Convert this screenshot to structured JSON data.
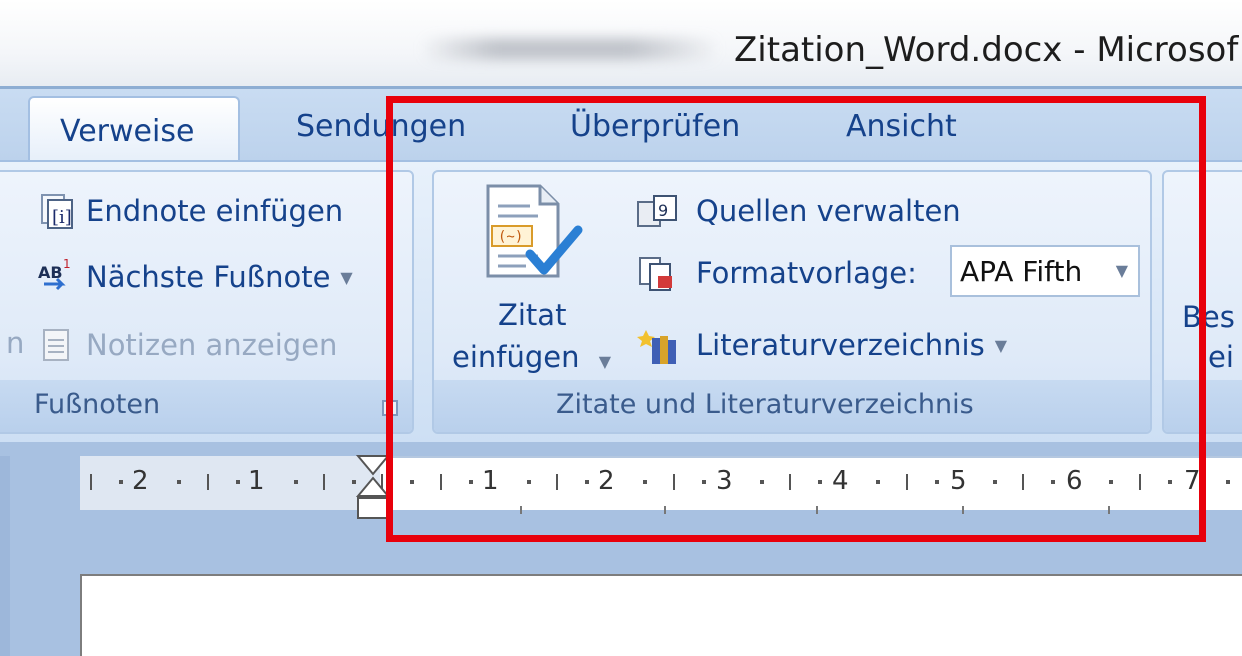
{
  "window": {
    "title": "Zitation_Word.docx - Microsof"
  },
  "tabs": [
    {
      "label": "Verweise",
      "active": true
    },
    {
      "label": "Sendungen"
    },
    {
      "label": "Überprüfen"
    },
    {
      "label": "Ansicht"
    }
  ],
  "footnotes_group": {
    "label": "Fußnoten",
    "endnote": "Endnote einfügen",
    "next_footnote": "Nächste Fußnote",
    "show_notes": "Notizen anzeigen",
    "left_edge_char": "n"
  },
  "citations_group": {
    "label": "Zitate und Literaturverzeichnis",
    "insert_citation_line1": "Zitat",
    "insert_citation_line2": "einfügen",
    "manage_sources": "Quellen verwalten",
    "style_label": "Formatvorlage:",
    "style_value": "APA Fifth",
    "bibliography": "Literaturverzeichnis"
  },
  "next_group": {
    "line1": "Bes",
    "line2": "ei"
  },
  "ruler": {
    "left_numbers": [
      "2",
      "1"
    ],
    "right_numbers": [
      "1",
      "2",
      "3",
      "4",
      "5",
      "6",
      "7"
    ]
  },
  "annotation": {
    "highlight_color": "#e8000b"
  }
}
